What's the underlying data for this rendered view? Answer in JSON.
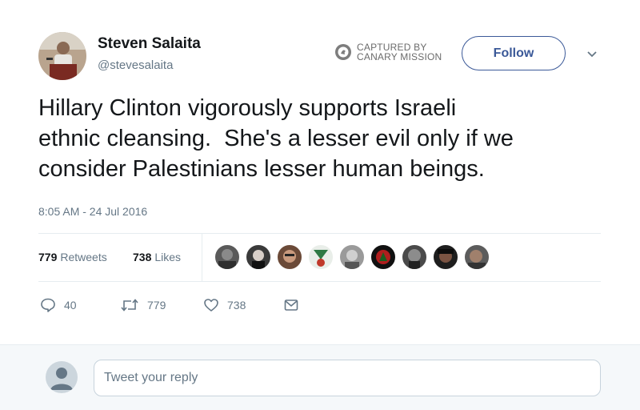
{
  "user": {
    "name": "Steven Salaita",
    "handle": "@stevesalaita"
  },
  "watermark": {
    "line1": "CAPTURED BY",
    "line2": "CANARY MISSION"
  },
  "follow_label": "Follow",
  "tweet": {
    "text": "Hillary Clinton vigorously supports Israeli\nethnic cleansing.  She's a lesser evil only if we\nconsider Palestinians lesser human beings.",
    "timestamp": "8:05 AM - 24 Jul 2016"
  },
  "stats": {
    "retweets_count": "779",
    "retweets_label": "Retweets",
    "likes_count": "738",
    "likes_label": "Likes"
  },
  "actions": {
    "reply_count": "40",
    "retweet_count": "779",
    "like_count": "738"
  },
  "reply": {
    "placeholder": "Tweet your reply"
  },
  "icons": {
    "reply": "speech-bubble-icon",
    "retweet": "retweet-arrows-icon",
    "like": "heart-icon",
    "message": "envelope-icon",
    "caret": "chevron-down-icon"
  },
  "colors": {
    "accent": "#3b5998",
    "muted": "#657786",
    "divider": "#e6ecf0",
    "reply_bg": "#f5f8fa"
  }
}
